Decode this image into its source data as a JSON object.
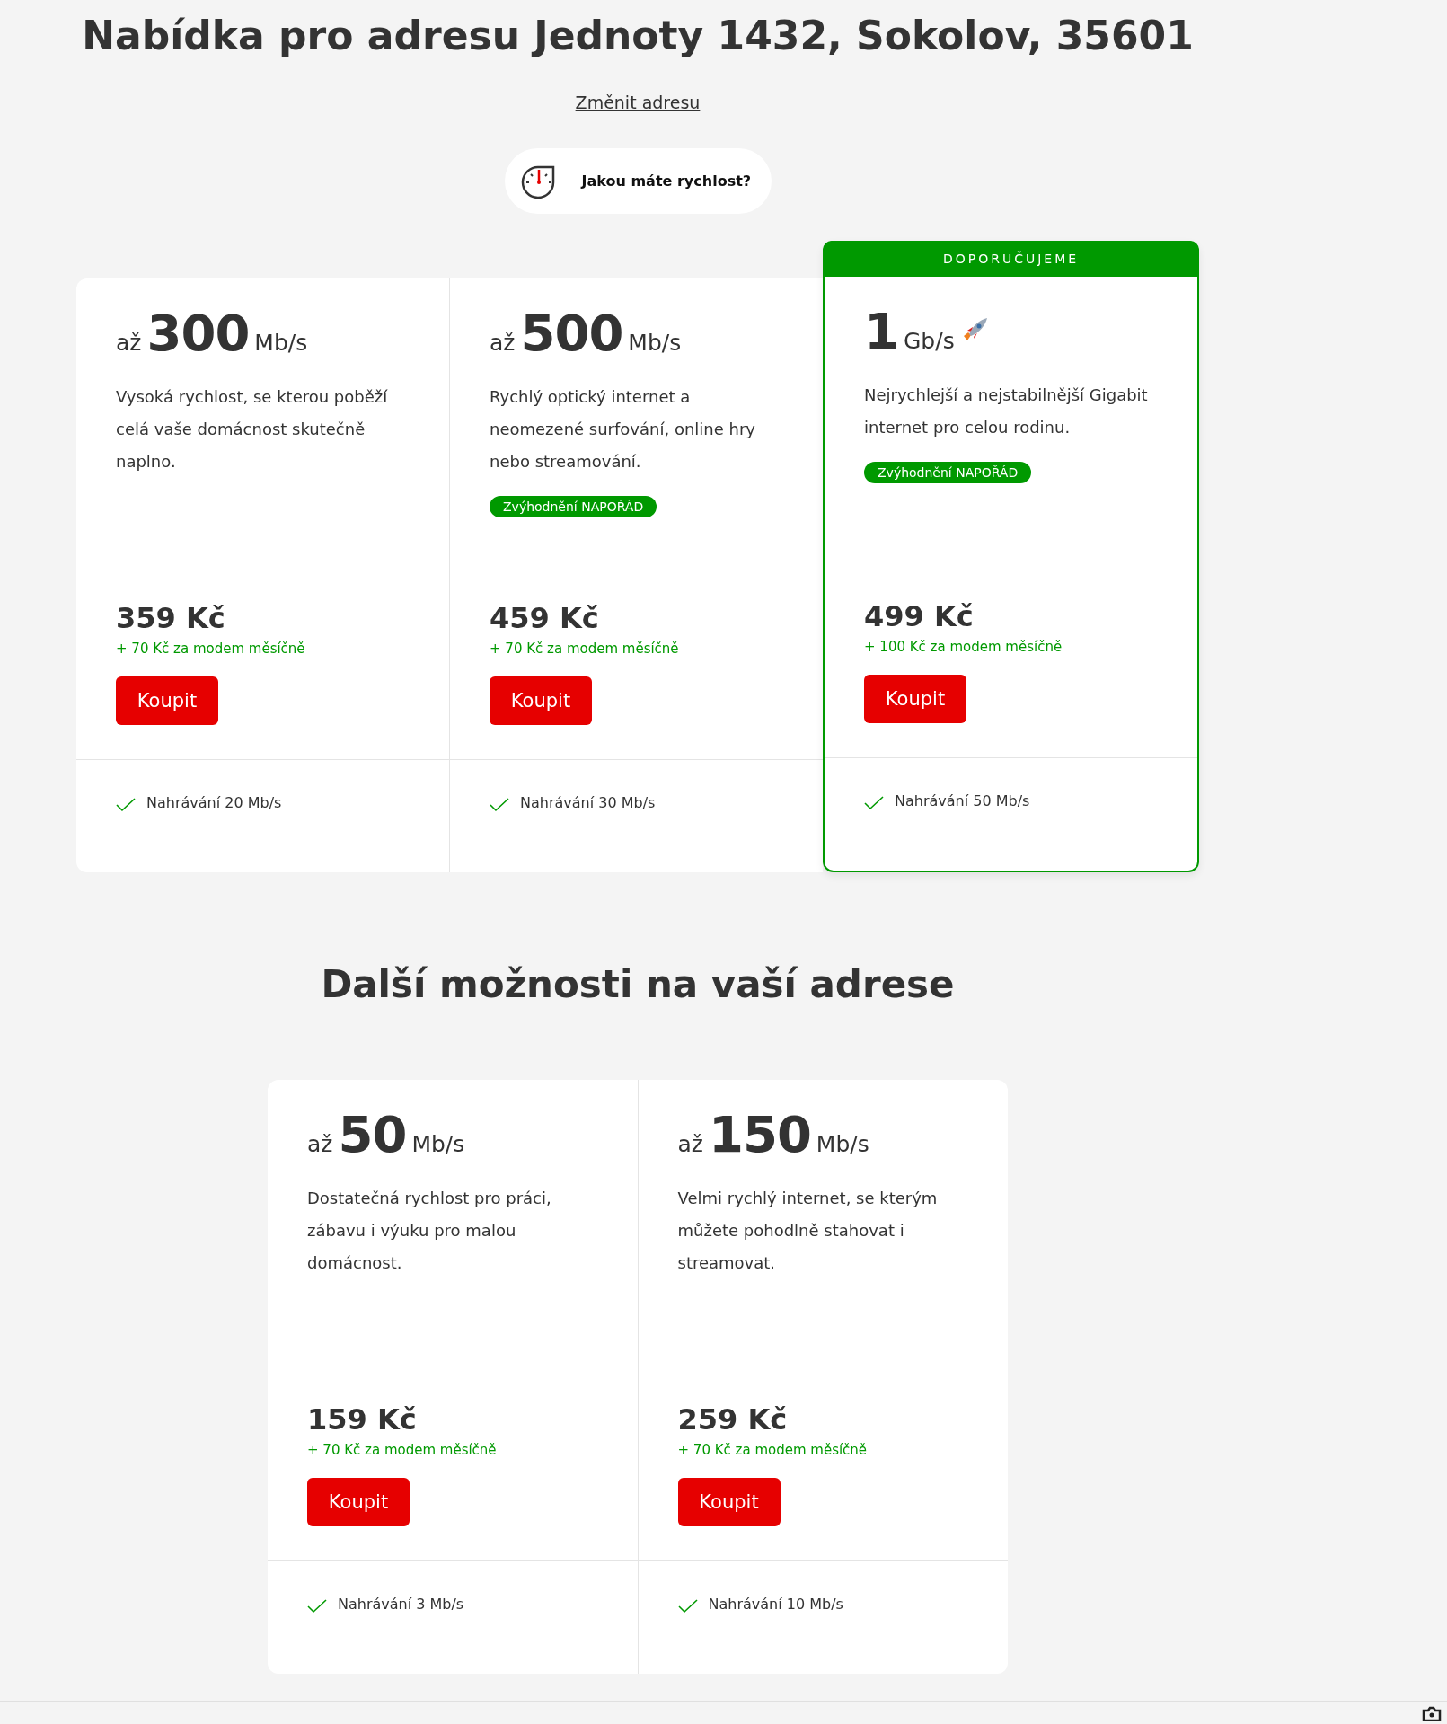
{
  "title": "Nabídka pro adresu Jednoty 1432, Sokolov, 35601",
  "change_link": "Změnit adresu",
  "speed_button": "Jakou máte rychlost?",
  "offers": [
    {
      "prefix": "až",
      "speed": "300",
      "unit": "Mb/s",
      "description": "Vysoká rychlost, se kterou poběží celá vaše domácnost skutečně naplno.",
      "price": "359 Kč",
      "modem": "+ 70 Kč za modem měsíčně",
      "buy": "Koupit",
      "upload": "Nahrávání 20 Mb/s",
      "recommended": false
    },
    {
      "prefix": "až",
      "speed": "500",
      "unit": "Mb/s",
      "description": "Rychlý optický internet a neomezené surfování, online hry nebo streamování.",
      "promo": "Zvýhodnění NAPOŘÁD",
      "price": "459 Kč",
      "modem": "+ 70 Kč za modem měsíčně",
      "buy": "Koupit",
      "upload": "Nahrávání 30 Mb/s",
      "recommended": false
    },
    {
      "speed": "1",
      "unit": "Gb/s",
      "description": "Nejrychlejší a nejstabilnější Gigabit internet pro celou rodinu.",
      "promo": "Zvýhodnění NAPOŘÁD",
      "price": "499 Kč",
      "modem": "+ 100 Kč za modem měsíčně",
      "buy": "Koupit",
      "upload": "Nahrávání 50 Mb/s",
      "recommended": true,
      "ribbon": "DOPORUČUJEME"
    }
  ],
  "more_title": "Další možnosti na vaší adrese",
  "more_offers": [
    {
      "prefix": "až",
      "speed": "50",
      "unit": "Mb/s",
      "description": "Dostatečná rychlost pro práci, zábavu i výuku pro malou domácnost.",
      "price": "159 Kč",
      "modem": "+ 70 Kč za modem měsíčně",
      "buy": "Koupit",
      "upload": "Nahrávání 3 Mb/s",
      "recommended": false
    },
    {
      "prefix": "až",
      "speed": "150",
      "unit": "Mb/s",
      "description": "Velmi rychlý internet, se kterým můžete pohodlně stahovat i streamovat.",
      "price": "259 Kč",
      "modem": "+ 70 Kč za modem měsíčně",
      "buy": "Koupit",
      "upload": "Nahrávání 10 Mb/s",
      "recommended": false
    }
  ]
}
